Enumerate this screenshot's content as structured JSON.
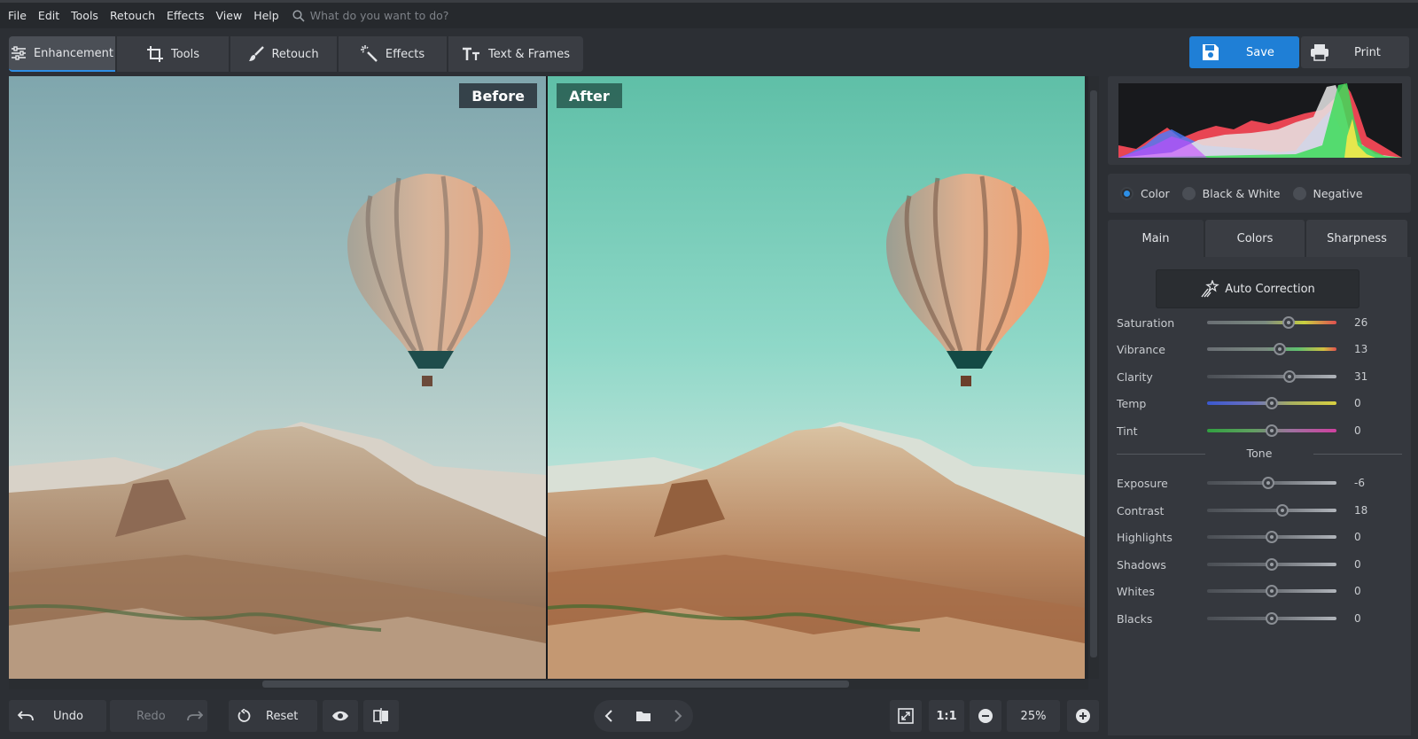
{
  "menu": {
    "items": [
      "File",
      "Edit",
      "Tools",
      "Retouch",
      "Effects",
      "View",
      "Help"
    ],
    "search_placeholder": "What do you want to do?"
  },
  "tabs": [
    {
      "label": "Enhancement",
      "icon": "sliders-icon",
      "active": true
    },
    {
      "label": "Tools",
      "icon": "crop-icon"
    },
    {
      "label": "Retouch",
      "icon": "brush-icon"
    },
    {
      "label": "Effects",
      "icon": "magic-wand-icon"
    },
    {
      "label": "Text & Frames",
      "icon": "text-icon"
    }
  ],
  "actions": {
    "save_label": "Save",
    "print_label": "Print"
  },
  "preview": {
    "before_label": "Before",
    "after_label": "After"
  },
  "histogram": {
    "colors": [
      "#ff4a5a",
      "#4a7bff",
      "#3ddc5a",
      "#f5e84a",
      "#e6e6e6",
      "#c84aff"
    ]
  },
  "color_modes": [
    {
      "label": "Color",
      "selected": true
    },
    {
      "label": "Black & White",
      "selected": false
    },
    {
      "label": "Negative",
      "selected": false
    }
  ],
  "panel_tabs": [
    {
      "label": "Main",
      "active": true
    },
    {
      "label": "Colors",
      "active": false
    },
    {
      "label": "Sharpness",
      "active": false
    }
  ],
  "auto_correction_label": "Auto Correction",
  "tone_label": "Tone",
  "sliders": [
    {
      "label": "Saturation",
      "value": "26",
      "position": 0.63
    },
    {
      "label": "Vibrance",
      "value": "13",
      "position": 0.56
    },
    {
      "label": "Clarity",
      "value": "31",
      "position": 0.64
    },
    {
      "label": "Temp",
      "value": "0",
      "position": 0.5
    },
    {
      "label": "Tint",
      "value": "0",
      "position": 0.5
    }
  ],
  "tone_sliders": [
    {
      "label": "Exposure",
      "value": "-6",
      "position": 0.47
    },
    {
      "label": "Contrast",
      "value": "18",
      "position": 0.58
    },
    {
      "label": "Highlights",
      "value": "0",
      "position": 0.5
    },
    {
      "label": "Shadows",
      "value": "0",
      "position": 0.5
    },
    {
      "label": "Whites",
      "value": "0",
      "position": 0.5
    },
    {
      "label": "Blacks",
      "value": "0",
      "position": 0.5
    }
  ],
  "bottom": {
    "undo_label": "Undo",
    "redo_label": "Redo",
    "reset_label": "Reset",
    "one_to_one_label": "1:1",
    "zoom_value": "25%"
  }
}
